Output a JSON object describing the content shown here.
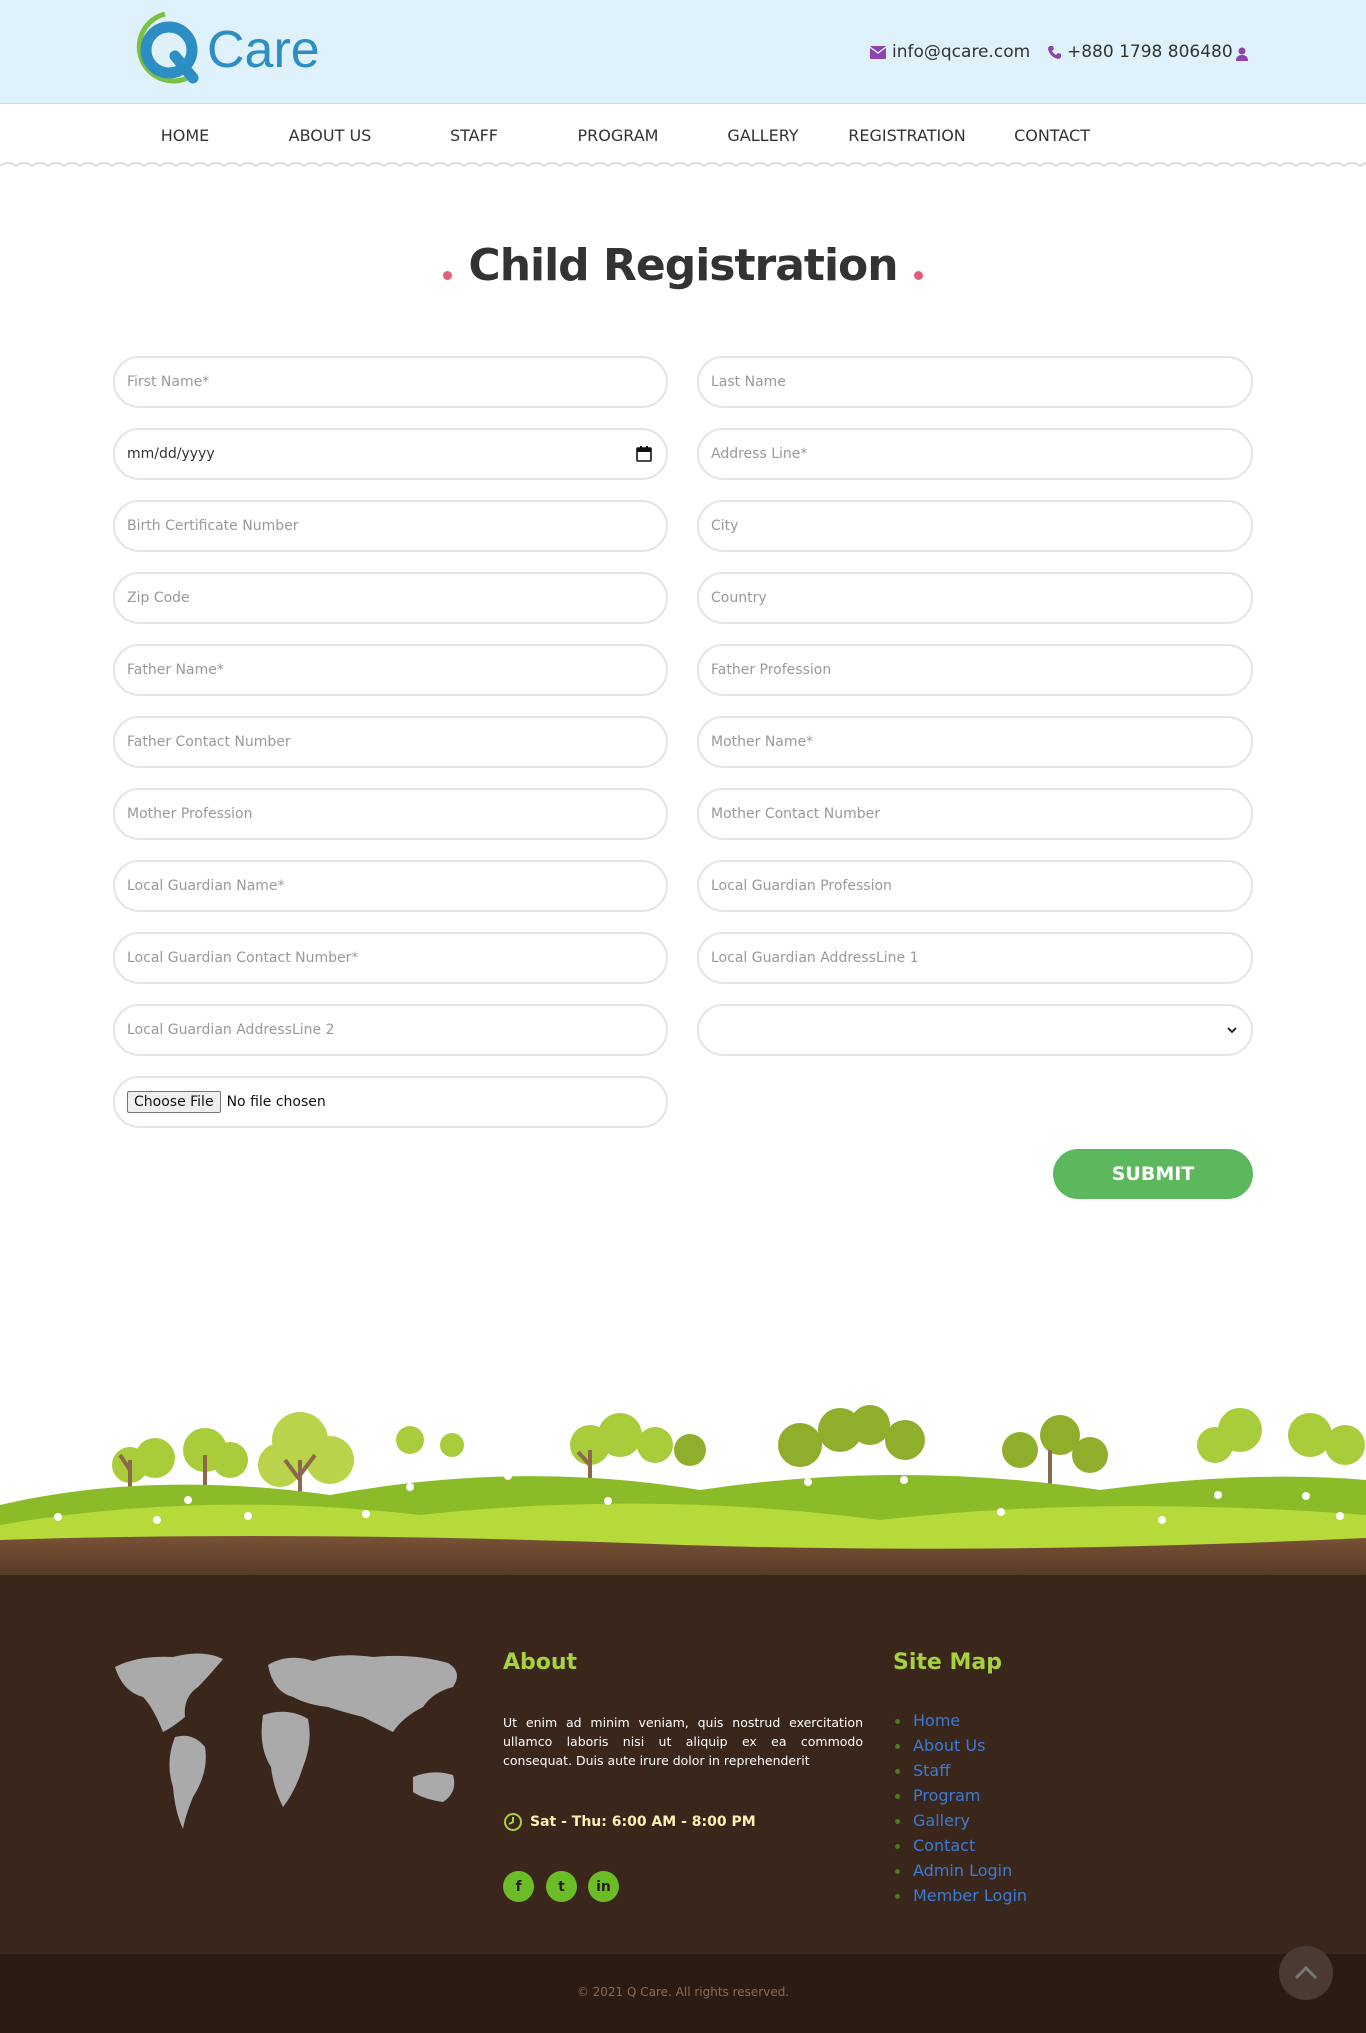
{
  "header": {
    "logo_text": "Care",
    "logo_mark": "Q",
    "email": "info@qcare.com",
    "phone": "+880 1798 806480",
    "icons": [
      "envelope-icon",
      "phone-icon",
      "user-icon"
    ],
    "colors": {
      "background": "#dff1fb",
      "logo_blue": "#2d8ec4",
      "logo_green": "#7ac142",
      "icon_purple": "#8e44ad"
    }
  },
  "nav": {
    "items": [
      {
        "label": "HOME"
      },
      {
        "label": "ABOUT US"
      },
      {
        "label": "STAFF"
      },
      {
        "label": "PROGRAM"
      },
      {
        "label": "GALLERY"
      },
      {
        "label": "REGISTRATION"
      },
      {
        "label": "CONTACT"
      }
    ]
  },
  "page": {
    "title": "Child Registration",
    "title_dot_color": "#e55d7d"
  },
  "form": {
    "first_name": "First Name*",
    "last_name": "Last Name",
    "dob_value": "mm/dd/yyyy",
    "address_line": "Address Line*",
    "birth_cert": "Birth Certificate Number",
    "city": "City",
    "zip": "Zip Code",
    "country": "Country",
    "father_name": "Father Name*",
    "father_profession": "Father Profession",
    "father_contact": "Father Contact Number",
    "mother_name": "Mother Name*",
    "mother_profession": "Mother Profession",
    "mother_contact": "Mother Contact Number",
    "guardian_name": "Local Guardian Name*",
    "guardian_profession": "Local Guardian Profession",
    "guardian_contact": "Local Guardian Contact Number*",
    "guardian_address1": "Local Guardian AddressLine 1",
    "guardian_address2": "Local Guardian AddressLine 2",
    "select_value": "",
    "file_button": "Choose File",
    "file_status": "No file chosen",
    "submit_label": "SUBMIT",
    "submit_color": "#5cb85c"
  },
  "footer": {
    "about_title": "About",
    "about_text": "Ut enim ad minim veniam, quis nostrud exercitation ullamco laboris nisi ut aliquip ex ea commodo consequat. Duis aute irure dolor in reprehenderit",
    "hours": "Sat - Thu: 6:00 AM - 8:00 PM",
    "social": [
      {
        "label": "f",
        "icon": "facebook-icon"
      },
      {
        "label": "t",
        "icon": "twitter-icon"
      },
      {
        "label": "in",
        "icon": "linkedin-icon"
      }
    ],
    "sitemap_title": "Site Map",
    "sitemap": [
      {
        "label": "Home"
      },
      {
        "label": "About Us"
      },
      {
        "label": "Staff"
      },
      {
        "label": "Program"
      },
      {
        "label": "Gallery"
      },
      {
        "label": "Contact"
      },
      {
        "label": "Admin Login"
      },
      {
        "label": "Member Login"
      }
    ],
    "copyright": "© 2021 Q Care. All rights reserved.",
    "colors": {
      "background": "#3b261c",
      "heading": "#a6d33b",
      "link": "#3a7bd5"
    }
  }
}
